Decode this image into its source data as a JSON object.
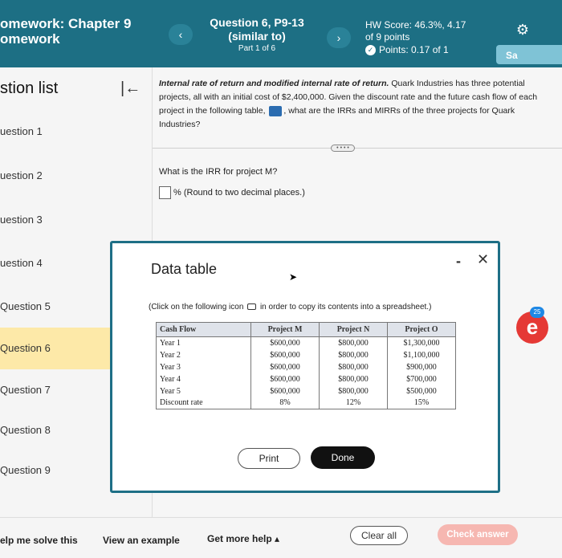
{
  "header": {
    "hw_line1": "omework: Chapter 9",
    "hw_line2": "omework",
    "question_title": "Question 6, P9-13",
    "question_sub": "(similar to)",
    "question_part": "Part 1 of 6",
    "prev_icon": "‹",
    "next_icon": "›",
    "score": "HW Score: 46.3%, 4.17",
    "points_total": "of 9 points",
    "points": "Points: 0.17 of 1",
    "save_label": "Sa"
  },
  "sidebar": {
    "title": "stion list",
    "collapse_icon": "|←",
    "items": [
      {
        "label": "uestion 1"
      },
      {
        "label": "uestion 2"
      },
      {
        "label": "uestion 3"
      },
      {
        "label": "uestion 4"
      },
      {
        "label": "Question 5"
      },
      {
        "label": "Question 6"
      },
      {
        "label": "Question 7"
      },
      {
        "label": "Question 8"
      },
      {
        "label": "Question 9"
      }
    ]
  },
  "main": {
    "intro_bold": "Internal rate of return and modified internal rate of return.",
    "intro_text": " Quark Industries has three potential projects, all with an initial cost of $2,400,000. Given the discount rate and the future cash flow of each project in the following table,",
    "intro_end": ", what are the IRRs and MIRRs of the three projects for Quark Industries?",
    "question": "What is the IRR for project M?",
    "answer_hint": "% (Round to two decimal places.)"
  },
  "modal": {
    "title": "Data table",
    "instr_pre": "(Click on the following icon",
    "instr_post": "in order to copy its contents into a spreadsheet.)",
    "headers": [
      "Cash Flow",
      "Project M",
      "Project N",
      "Project O"
    ],
    "rows": [
      [
        "Year 1",
        "$600,000",
        "$800,000",
        "$1,300,000"
      ],
      [
        "Year 2",
        "$600,000",
        "$800,000",
        "$1,100,000"
      ],
      [
        "Year 3",
        "$600,000",
        "$800,000",
        "$900,000"
      ],
      [
        "Year 4",
        "$600,000",
        "$800,000",
        "$700,000"
      ],
      [
        "Year 5",
        "$600,000",
        "$800,000",
        "$500,000"
      ],
      [
        "Discount rate",
        "8%",
        "12%",
        "15%"
      ]
    ],
    "print_label": "Print",
    "done_label": "Done"
  },
  "footer": {
    "help_solve": "elp me solve this",
    "view_example": "View an example",
    "more_help": "Get more help ▴",
    "clear_all": "Clear all",
    "check_answer": "Check answer"
  },
  "floating": {
    "badge": "e",
    "count": "25"
  },
  "colors": {
    "header": "#1d6f84",
    "active_item": "#fde9a8",
    "check_btn": "#f6b7b1"
  }
}
